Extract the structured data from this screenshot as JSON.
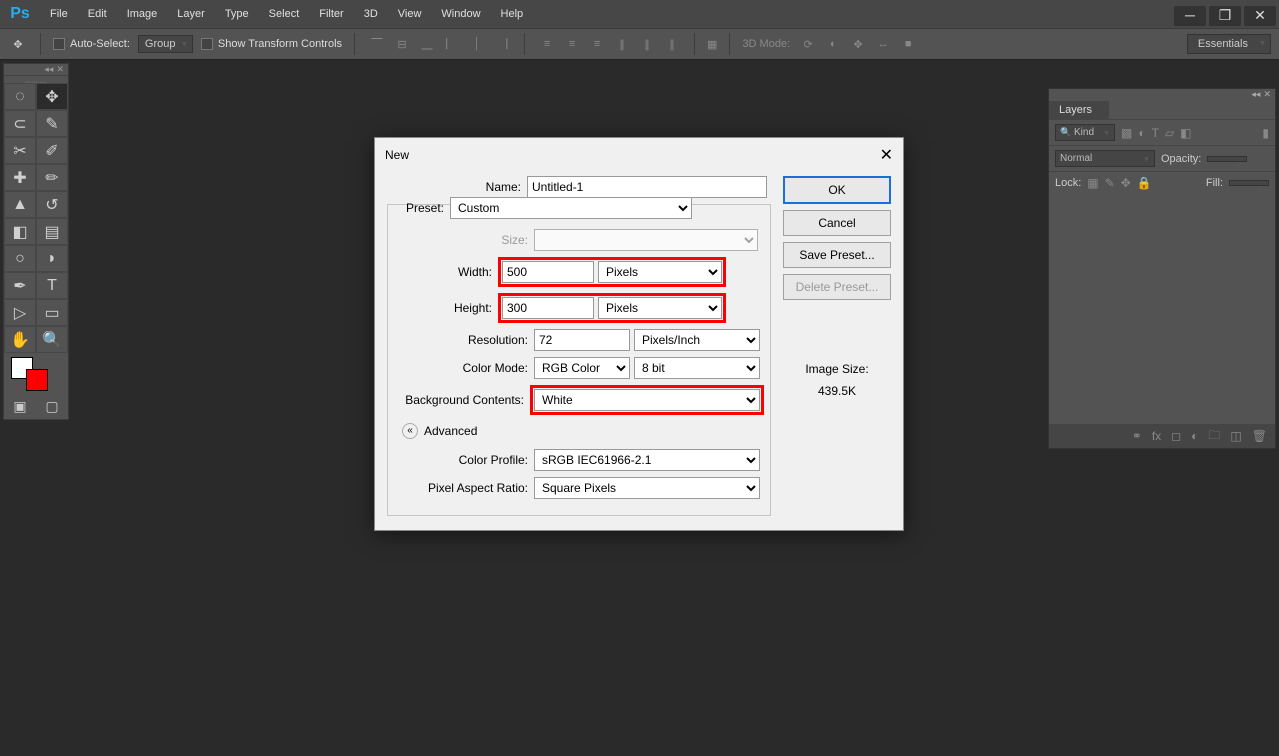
{
  "menu": [
    "File",
    "Edit",
    "Image",
    "Layer",
    "Type",
    "Select",
    "Filter",
    "3D",
    "View",
    "Window",
    "Help"
  ],
  "optbar": {
    "auto_select": "Auto-Select:",
    "group": "Group",
    "show_transform": "Show Transform Controls",
    "mode_3d": "3D Mode:",
    "workspace": "Essentials"
  },
  "layers": {
    "tab": "Layers",
    "kind": "Kind",
    "blend": "Normal",
    "opacity_lbl": "Opacity:",
    "lock_lbl": "Lock:",
    "fill_lbl": "Fill:"
  },
  "dialog": {
    "title": "New",
    "name_lbl": "Name:",
    "name_val": "Untitled-1",
    "preset_lbl": "Preset:",
    "preset_val": "Custom",
    "size_lbl": "Size:",
    "width_lbl": "Width:",
    "width_val": "500",
    "width_unit": "Pixels",
    "height_lbl": "Height:",
    "height_val": "300",
    "height_unit": "Pixels",
    "res_lbl": "Resolution:",
    "res_val": "72",
    "res_unit": "Pixels/Inch",
    "color_lbl": "Color Mode:",
    "color_val": "RGB Color",
    "depth_val": "8 bit",
    "bg_lbl": "Background Contents:",
    "bg_val": "White",
    "adv": "Advanced",
    "profile_lbl": "Color Profile:",
    "profile_val": "sRGB IEC61966-2.1",
    "par_lbl": "Pixel Aspect Ratio:",
    "par_val": "Square Pixels",
    "ok": "OK",
    "cancel": "Cancel",
    "save_preset": "Save Preset...",
    "delete_preset": "Delete Preset...",
    "img_size_lbl": "Image Size:",
    "img_size_val": "439.5K"
  }
}
